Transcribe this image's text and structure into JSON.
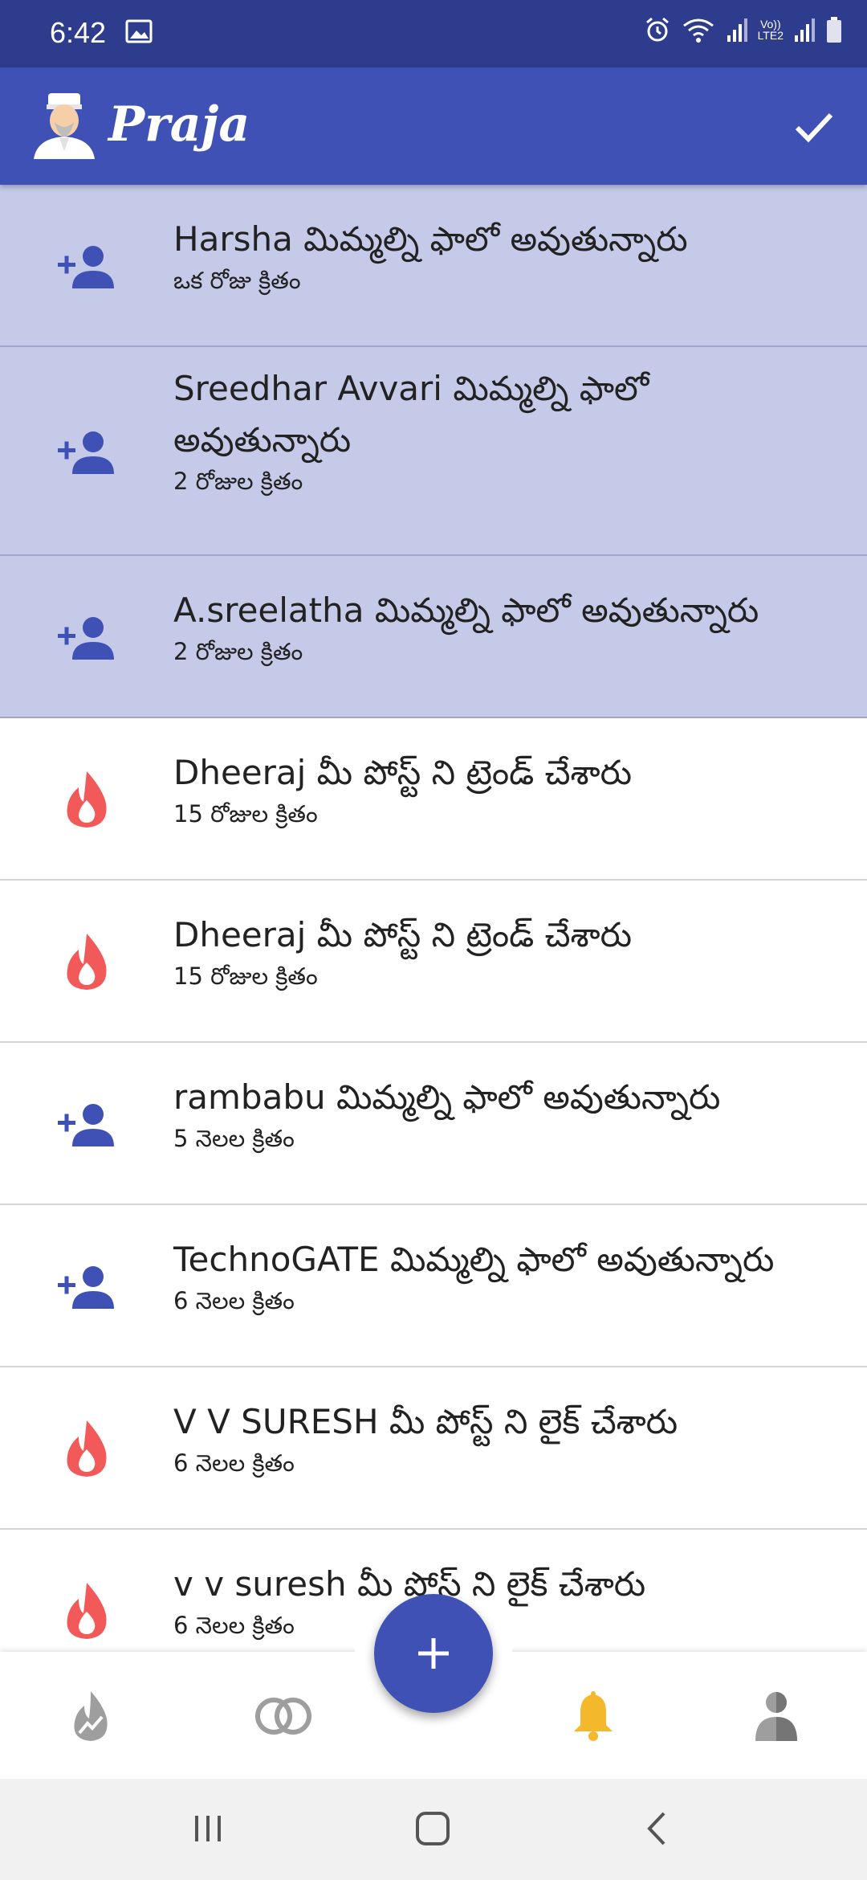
{
  "status_bar": {
    "time": "6:42",
    "network_label": "Vo))\nLTE2",
    "icons": [
      "image-icon",
      "alarm-icon",
      "wifi-icon",
      "signal-icon",
      "signal-icon",
      "battery-icon"
    ]
  },
  "app_bar": {
    "title": "Praja",
    "action_icon": "check-icon"
  },
  "colors": {
    "primary": "#3f51b5",
    "status_bar": "#2e3c8e",
    "unread_background": "#c5cae9",
    "fire": "#f25a5a",
    "bell": "#f4b82d"
  },
  "notifications": [
    {
      "icon": "person-add-icon",
      "title": "Harsha మిమ్మల్ని ఫాలో అవుతున్నారు",
      "time": "ఒక రోజు క్రితం",
      "unread": true
    },
    {
      "icon": "person-add-icon",
      "title": "Sreedhar Avvari మిమ్మల్ని ఫాలో అవుతున్నారు",
      "time": "2 రోజుల క్రితం",
      "unread": true
    },
    {
      "icon": "person-add-icon",
      "title": "A.sreelatha మిమ్మల్ని ఫాలో అవుతున్నారు",
      "time": "2 రోజుల క్రితం",
      "unread": true
    },
    {
      "icon": "fire-icon",
      "title": "Dheeraj మీ పోస్ట్ ని ట్రెండ్ చేశారు",
      "time": "15 రోజుల క్రితం",
      "unread": false
    },
    {
      "icon": "fire-icon",
      "title": "Dheeraj మీ పోస్ట్ ని ట్రెండ్ చేశారు",
      "time": "15 రోజుల క్రితం",
      "unread": false
    },
    {
      "icon": "person-add-icon",
      "title": "rambabu మిమ్మల్ని ఫాలో అవుతున్నారు",
      "time": "5 నెలల క్రితం",
      "unread": false
    },
    {
      "icon": "person-add-icon",
      "title": "TechnoGATE మిమ్మల్ని ఫాలో అవుతున్నారు",
      "time": "6 నెలల క్రితం",
      "unread": false
    },
    {
      "icon": "fire-icon",
      "title": "V V SURESH మీ పోస్ట్ ని లైక్ చేశారు",
      "time": "6 నెలల క్రితం",
      "unread": false
    },
    {
      "icon": "fire-icon",
      "title": "v v suresh మీ పోస్ట్ ని లైక్ చేశారు",
      "time": "6 నెలల క్రితం",
      "unread": false
    }
  ],
  "bottom_nav": {
    "items": [
      {
        "icon": "trending-fire-icon",
        "active": false
      },
      {
        "icon": "rings-icon",
        "active": false
      },
      {
        "icon": "bell-icon",
        "active": true
      },
      {
        "icon": "profile-icon",
        "active": false
      }
    ],
    "fab_icon": "plus-icon"
  },
  "system_nav": [
    "recents-icon",
    "home-icon",
    "back-icon"
  ]
}
